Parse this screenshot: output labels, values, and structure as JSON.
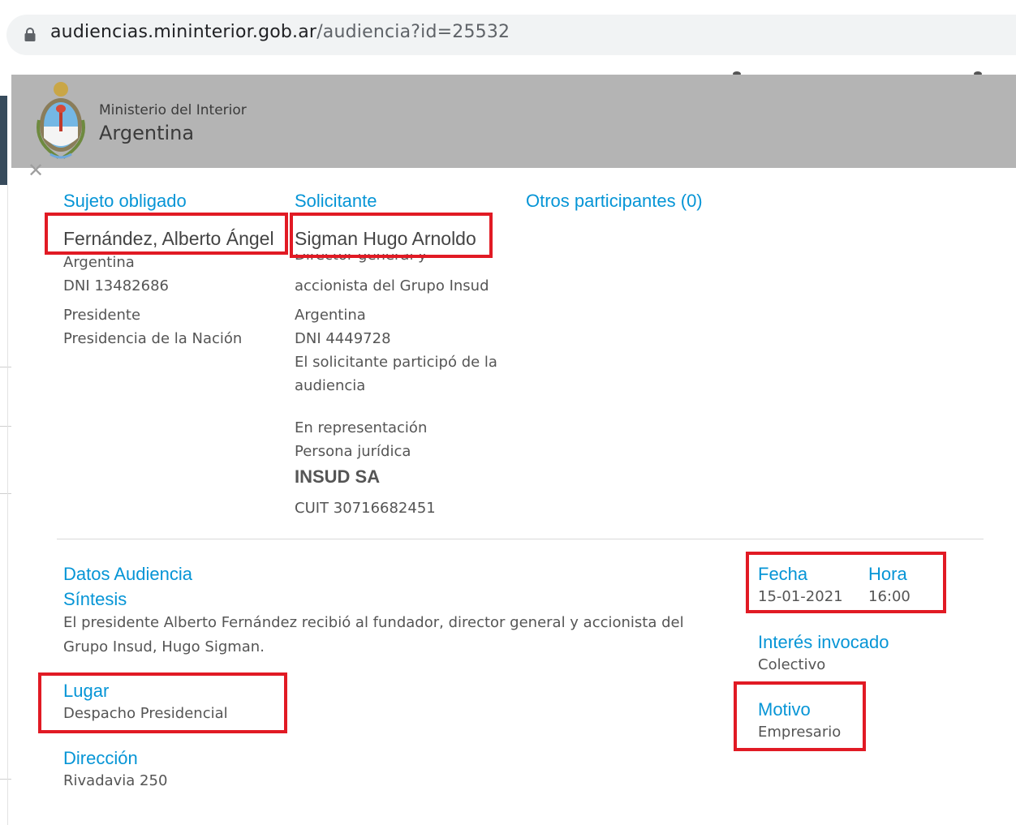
{
  "browser": {
    "url_host": "audiencias.mininterior.gob.ar",
    "url_path": "/audiencia?id=25532"
  },
  "header": {
    "org_top": "Ministerio del Interior",
    "org_main": "Argentina"
  },
  "sujeto_obligado": {
    "heading": "Sujeto obligado",
    "name": "Fernández, Alberto Ángel",
    "country": "Argentina",
    "dni": "DNI 13482686",
    "cargo": "Presidente",
    "organismo": "Presidencia de la Nación"
  },
  "solicitante": {
    "heading": "Solicitante",
    "name": "Sigman Hugo Arnoldo",
    "role_line1": "Director general y",
    "role_line2": "accionista del Grupo Insud",
    "country": "Argentina",
    "dni": "DNI 4449728",
    "participation_line1": "El solicitante participó de la",
    "participation_line2": "audiencia",
    "representation": "En representación",
    "persona": "Persona jurídica",
    "company": "INSUD SA",
    "cuit": "CUIT 30716682451"
  },
  "otros": {
    "heading": "Otros participantes (0)"
  },
  "datos": {
    "heading": "Datos Audiencia",
    "sintesis_label": "Síntesis",
    "sintesis_line1": "El presidente Alberto Fernández recibió al fundador, director general y accionista del",
    "sintesis_line2": "Grupo Insud, Hugo Sigman.",
    "lugar_label": "Lugar",
    "lugar_value": "Despacho Presidencial",
    "direccion_label": "Dirección",
    "direccion_value": "Rivadavia 250",
    "fecha_label": "Fecha",
    "fecha_value": "15-01-2021",
    "hora_label": "Hora",
    "hora_value": "16:00",
    "interes_label": "Interés invocado",
    "interes_value": "Colectivo",
    "motivo_label": "Motivo",
    "motivo_value": "Empresario"
  },
  "colors": {
    "heading": "#0695d6",
    "highlight_box": "#e11a24",
    "header_bar": "#b4b4b4"
  }
}
